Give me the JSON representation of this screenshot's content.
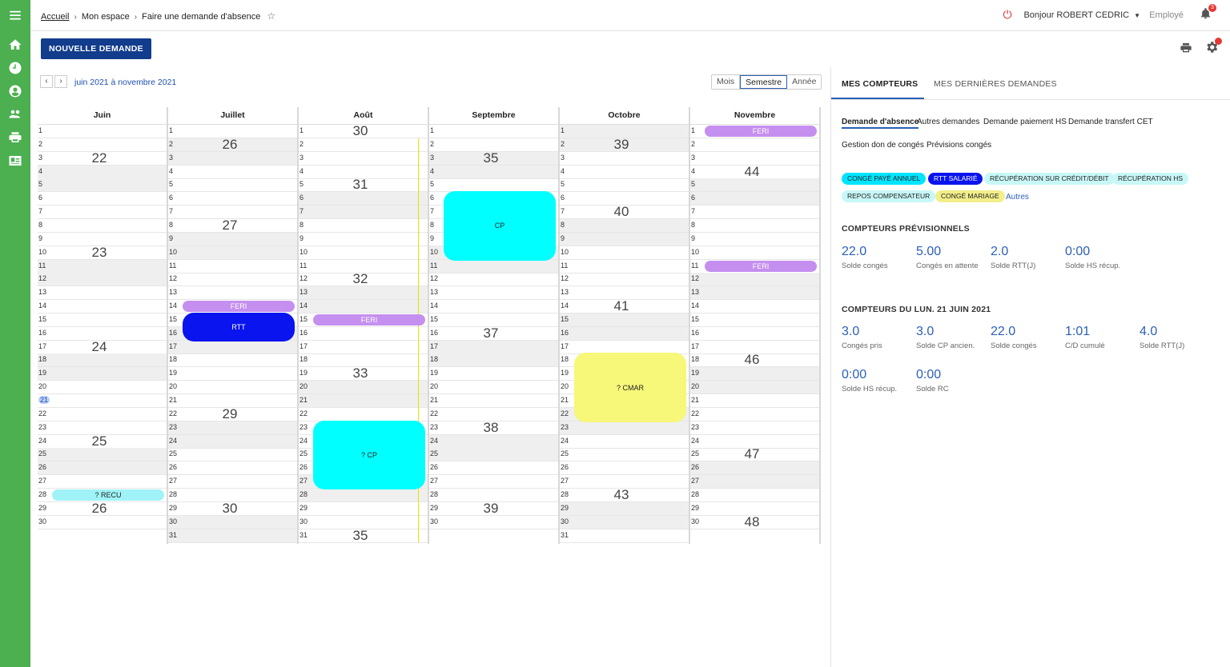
{
  "colors": {
    "green": "#4caf50",
    "navy": "#123c8c",
    "cyan": "#00ffff",
    "lilac": "#c58fef",
    "blue": "#0a14ee",
    "yellow": "#f7f77a",
    "lightcyan": "#9ff3f7"
  },
  "rail_icons": [
    "menu-icon",
    "home-icon",
    "clock-icon",
    "user-icon",
    "group-icon",
    "print-icon",
    "id-card-icon"
  ],
  "breadcrumb": {
    "home": "Accueil",
    "space": "Mon espace",
    "current": "Faire une demande d'absence"
  },
  "header": {
    "user": "Bonjour ROBERT CEDRIC",
    "role": "Employé",
    "notifications": "3"
  },
  "toolbar": {
    "new_request": "NOUVELLE DEMANDE"
  },
  "calendar": {
    "range": "juin 2021 à novembre 2021",
    "views": [
      "Mois",
      "Semestre",
      "Année"
    ],
    "months": [
      {
        "name": "Juin",
        "days": 30,
        "first_dow": 2
      },
      {
        "name": "Juillet",
        "days": 31,
        "first_dow": 4
      },
      {
        "name": "Août",
        "days": 31,
        "first_dow": 0
      },
      {
        "name": "Septembre",
        "days": 30,
        "first_dow": 3
      },
      {
        "name": "Octobre",
        "days": 31,
        "first_dow": 5
      },
      {
        "name": "Novembre",
        "days": 30,
        "first_dow": 1
      }
    ],
    "today": {
      "month": 0,
      "day": 21
    },
    "weeks": [
      [
        [
          "22",
          3
        ],
        [
          "23",
          10
        ],
        [
          "24",
          17
        ],
        [
          "25",
          24
        ],
        [
          "26",
          29
        ]
      ],
      [
        [
          "26",
          2
        ],
        [
          "27",
          8
        ],
        [
          "29",
          22
        ],
        [
          "30",
          29
        ]
      ],
      [
        [
          "30",
          1
        ],
        [
          "31",
          5
        ],
        [
          "32",
          12
        ],
        [
          "33",
          19
        ],
        [
          "35",
          31
        ]
      ],
      [
        [
          "35",
          3
        ],
        [
          "37",
          16
        ],
        [
          "38",
          23
        ],
        [
          "39",
          29
        ]
      ],
      [
        [
          "39",
          2
        ],
        [
          "40",
          7
        ],
        [
          "41",
          14
        ],
        [
          "43",
          28
        ]
      ],
      [
        [
          "44",
          4
        ],
        [
          "46",
          18
        ],
        [
          "47",
          25
        ],
        [
          "48",
          30
        ]
      ]
    ],
    "events": [
      {
        "month": 0,
        "from": 28,
        "to": 28,
        "label": "? RECU",
        "color": "lightcyan",
        "kind": "pill"
      },
      {
        "month": 1,
        "from": 14,
        "to": 14,
        "label": "FERI",
        "color": "lilac",
        "kind": "pill"
      },
      {
        "month": 1,
        "from": 15,
        "to": 16,
        "label": "RTT",
        "color": "blue",
        "kind": "block"
      },
      {
        "month": 2,
        "from": 15,
        "to": 15,
        "label": "FERI",
        "color": "lilac",
        "kind": "pill"
      },
      {
        "month": 2,
        "from": 23,
        "to": 27,
        "label": "? CP",
        "color": "cyan",
        "kind": "block"
      },
      {
        "month": 3,
        "from": 6,
        "to": 10,
        "label": "CP",
        "color": "cyan",
        "kind": "block"
      },
      {
        "month": 4,
        "from": 18,
        "to": 22,
        "label": "? CMAR",
        "color": "yellow",
        "kind": "block"
      },
      {
        "month": 5,
        "from": 1,
        "to": 1,
        "label": "FERI",
        "color": "lilac",
        "kind": "pill"
      },
      {
        "month": 5,
        "from": 11,
        "to": 11,
        "label": "FERI",
        "color": "lilac",
        "kind": "pill"
      }
    ]
  },
  "panel": {
    "tabs": [
      "MES COMPTEURS",
      "MES DERNIÈRES DEMANDES"
    ],
    "subtabs": [
      "Demande d'absence",
      "Autres demandes",
      "Demande paiement HS",
      "Demande transfert CET",
      "Gestion don de congés",
      "Prévisions congés"
    ],
    "chips": [
      "CONGÉ PAYÉ ANNUEL",
      "RTT SALARIÉ",
      "RÉCUPÉRATION SUR CRÉDIT/DÉBIT",
      "RÉCUPÉRATION HS",
      "REPOS COMPENSATEUR",
      "CONGÉ MARIAGE"
    ],
    "more": "Autres",
    "section1": "COMPTEURS PRÉVISIONNELS",
    "counters1": [
      {
        "value": "22.0",
        "label": "Solde congés"
      },
      {
        "value": "5.00",
        "label": "Congés en attente"
      },
      {
        "value": "2.0",
        "label": "Solde RTT(J)"
      },
      {
        "value": "0:00",
        "label": "Solde HS récup."
      }
    ],
    "section2": "COMPTEURS DU LUN. 21 JUIN 2021",
    "counters2": [
      {
        "value": "3.0",
        "label": "Congés pris"
      },
      {
        "value": "3.0",
        "label": "Solde CP ancien."
      },
      {
        "value": "22.0",
        "label": "Solde congés"
      },
      {
        "value": "1:01",
        "label": "C/D cumulé"
      },
      {
        "value": "4.0",
        "label": "Solde RTT(J)"
      },
      {
        "value": "0:00",
        "label": "Solde HS récup."
      },
      {
        "value": "0:00",
        "label": "Solde RC"
      }
    ]
  }
}
